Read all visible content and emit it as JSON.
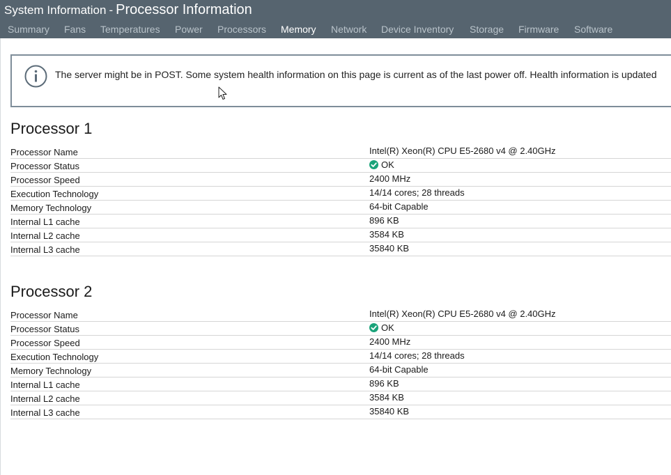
{
  "header": {
    "title_prefix": "System Information",
    "title_separator": "-",
    "title_main": "Processor Information",
    "background": "#56646f"
  },
  "tabs": [
    {
      "label": "Summary",
      "active": false
    },
    {
      "label": "Fans",
      "active": false
    },
    {
      "label": "Temperatures",
      "active": false
    },
    {
      "label": "Power",
      "active": false
    },
    {
      "label": "Processors",
      "active": false
    },
    {
      "label": "Memory",
      "active": true
    },
    {
      "label": "Network",
      "active": false
    },
    {
      "label": "Device Inventory",
      "active": false
    },
    {
      "label": "Storage",
      "active": false
    },
    {
      "label": "Firmware",
      "active": false
    },
    {
      "label": "Software",
      "active": false
    }
  ],
  "banner": {
    "icon": "info-icon",
    "text": "The server might be in POST. Some system health information on this page is current as of the last power off. Health information is updated"
  },
  "processors": [
    {
      "title": "Processor 1",
      "rows": [
        {
          "label": "Processor Name",
          "value": "Intel(R) Xeon(R) CPU E5-2680 v4 @ 2.40GHz"
        },
        {
          "label": "Processor Status",
          "value": "OK",
          "status_icon": "check-circle-icon"
        },
        {
          "label": "Processor Speed",
          "value": "2400 MHz"
        },
        {
          "label": "Execution Technology",
          "value": "14/14 cores; 28 threads"
        },
        {
          "label": "Memory Technology",
          "value": "64-bit Capable"
        },
        {
          "label": "Internal L1 cache",
          "value": "896 KB"
        },
        {
          "label": "Internal L2 cache",
          "value": "3584 KB"
        },
        {
          "label": "Internal L3 cache",
          "value": "35840 KB"
        }
      ]
    },
    {
      "title": "Processor 2",
      "rows": [
        {
          "label": "Processor Name",
          "value": "Intel(R) Xeon(R) CPU E5-2680 v4 @ 2.40GHz"
        },
        {
          "label": "Processor Status",
          "value": "OK",
          "status_icon": "check-circle-icon"
        },
        {
          "label": "Processor Speed",
          "value": "2400 MHz"
        },
        {
          "label": "Execution Technology",
          "value": "14/14 cores; 28 threads"
        },
        {
          "label": "Memory Technology",
          "value": "64-bit Capable"
        },
        {
          "label": "Internal L1 cache",
          "value": "896 KB"
        },
        {
          "label": "Internal L2 cache",
          "value": "3584 KB"
        },
        {
          "label": "Internal L3 cache",
          "value": "35840 KB"
        }
      ]
    }
  ],
  "colors": {
    "ok_green": "#1aa37a",
    "info_icon": "#5b6b78",
    "tab_inactive": "#b9c3ca",
    "tab_active": "#ffffff"
  }
}
